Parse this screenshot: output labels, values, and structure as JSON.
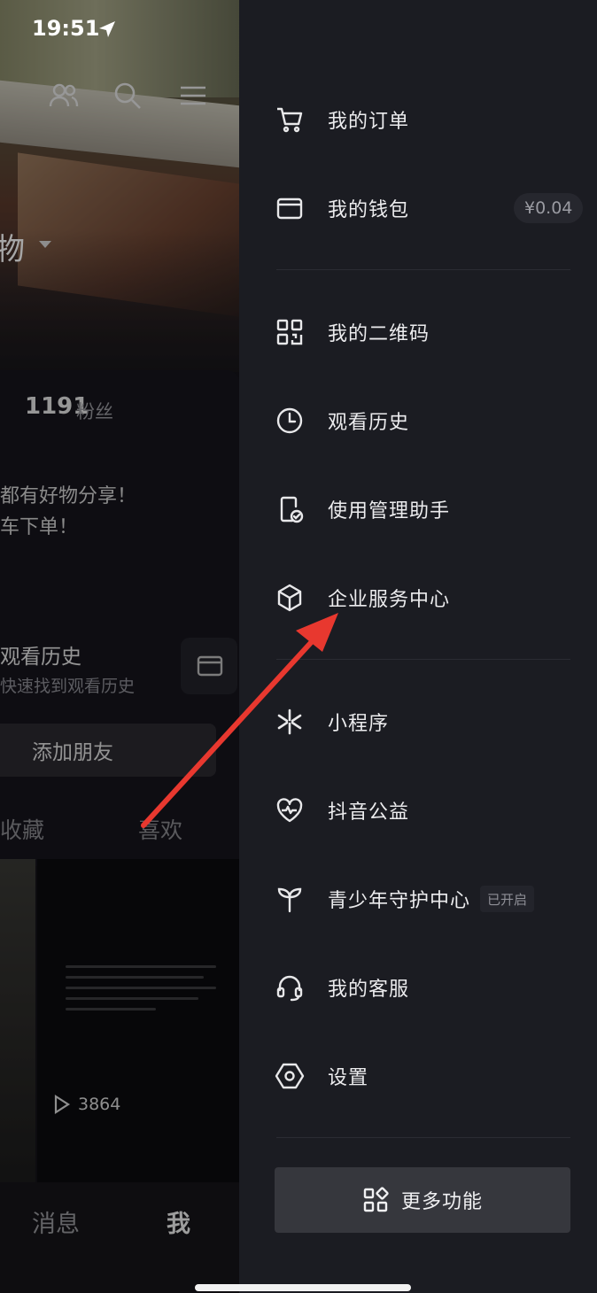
{
  "status_bar": {
    "time": "19:51"
  },
  "profile": {
    "name_partial": "物",
    "followers_count": "1191",
    "followers_label": "粉丝",
    "bio_line1": "都有好物分享！",
    "bio_line2": "车下单！",
    "history_title": "观看历史",
    "history_subtitle": "快速找到观看历史",
    "add_friend": "添加朋友",
    "tab_favorites": "收藏",
    "tab_likes": "喜欢",
    "video_play_count": "3864"
  },
  "bottom_nav": {
    "messages": "消息",
    "me": "我"
  },
  "drawer": {
    "group1": [
      {
        "label": "我的订单",
        "icon": "cart-icon"
      },
      {
        "label": "我的钱包",
        "icon": "wallet-icon",
        "badge": "¥0.04"
      }
    ],
    "group2": [
      {
        "label": "我的二维码",
        "icon": "qr-code-icon"
      },
      {
        "label": "观看历史",
        "icon": "clock-icon"
      },
      {
        "label": "使用管理助手",
        "icon": "phone-check-icon"
      },
      {
        "label": "企业服务中心",
        "icon": "cube-icon"
      }
    ],
    "group3": [
      {
        "label": "小程序",
        "icon": "asterisk-icon"
      },
      {
        "label": "抖音公益",
        "icon": "heart-pulse-icon"
      },
      {
        "label": "青少年守护中心",
        "icon": "sprout-icon",
        "badge": "已开启"
      },
      {
        "label": "我的客服",
        "icon": "headset-icon"
      },
      {
        "label": "设置",
        "icon": "hexagon-gear-icon"
      }
    ],
    "more_button": "更多功能"
  },
  "colors": {
    "drawer_bg": "#1b1c22",
    "annotation_arrow": "#e8382f"
  }
}
